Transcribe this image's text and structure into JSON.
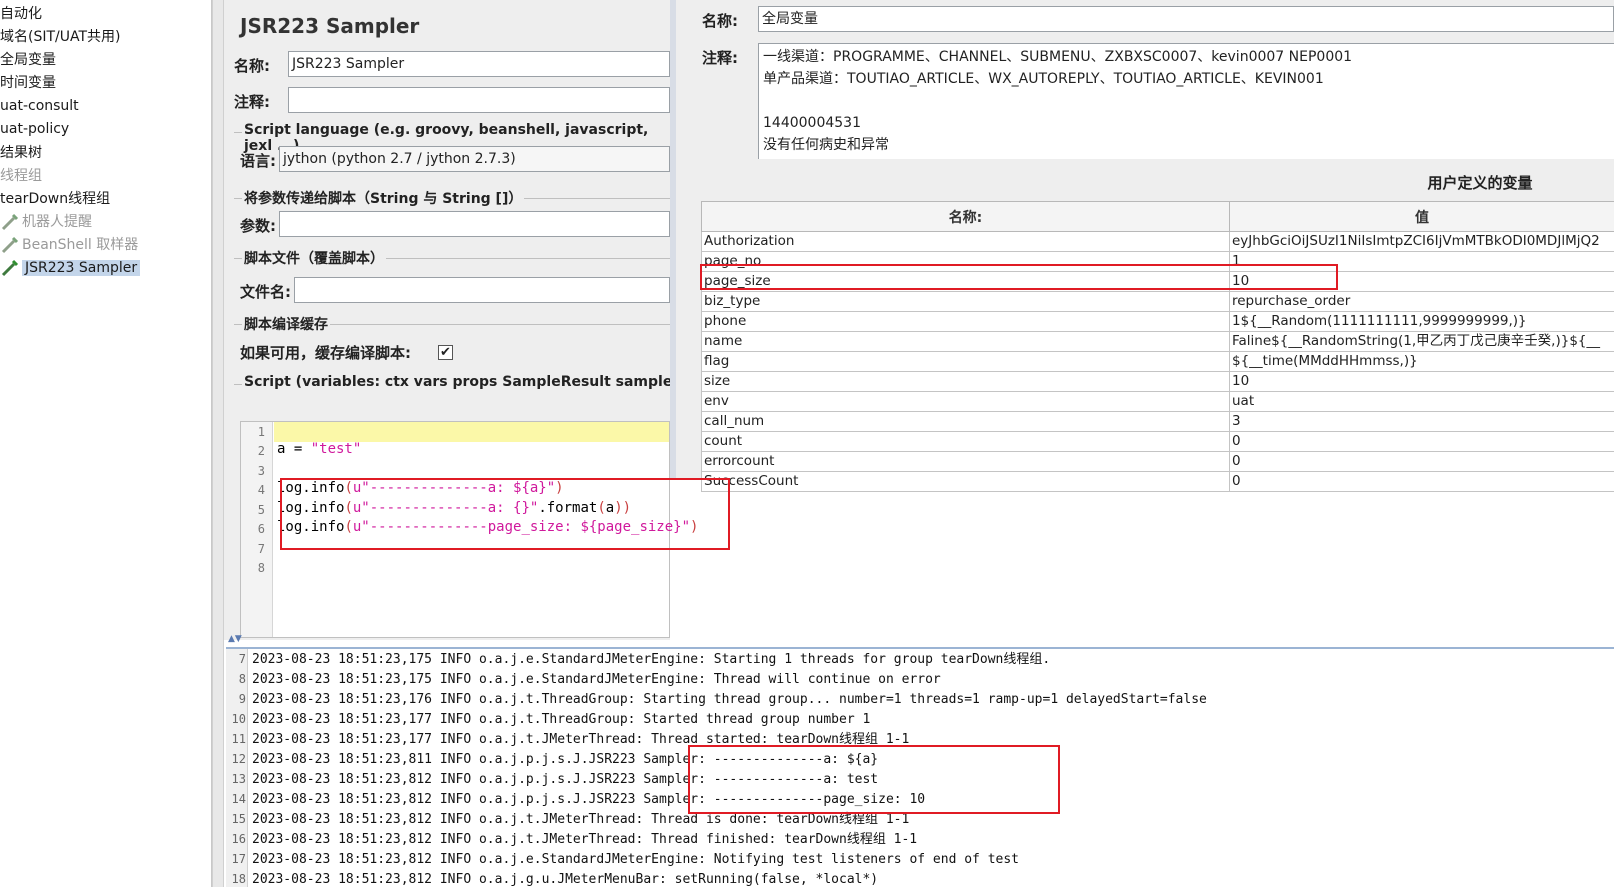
{
  "tree": {
    "items": [
      {
        "label": "自动化",
        "state": "normal"
      },
      {
        "label": "域名(SIT/UAT共用)",
        "state": "normal"
      },
      {
        "label": "全局变量",
        "state": "normal"
      },
      {
        "label": "时间变量",
        "state": "normal"
      },
      {
        "label": "uat-consult",
        "state": "normal"
      },
      {
        "label": "uat-policy",
        "state": "normal"
      },
      {
        "label": "结果树",
        "state": "normal"
      },
      {
        "label": "线程组",
        "state": "disabled"
      },
      {
        "label": "tearDown线程组",
        "state": "normal"
      },
      {
        "label": "机器人提醒",
        "state": "disabled",
        "icon": "pipette-icon"
      },
      {
        "label": "BeanShell 取样器",
        "state": "disabled",
        "icon": "pipette-icon"
      },
      {
        "label": "JSR223 Sampler",
        "state": "selected",
        "icon": "pipette-icon"
      }
    ]
  },
  "sampler": {
    "title": "JSR223 Sampler",
    "name_label": "名称:",
    "name_value": "JSR223 Sampler",
    "comment_label": "注释:",
    "comment_value": "",
    "lang_group": "Script language (e.g. groovy, beanshell, javascript, jexl ...)",
    "lang_label": "语言:",
    "lang_value": "jython     (python 2.7 / jython 2.7.3)",
    "params_group": "将参数传递给脚本（String 与 String []）",
    "params_label": "参数:",
    "params_value": "",
    "file_group": "脚本文件（覆盖脚本）",
    "file_label": "文件名:",
    "file_value": "",
    "cache_group": "脚本编译缓存",
    "cache_label": "如果可用，缓存编译脚本:",
    "cache_checked": "✔",
    "script_group": "Script (variables: ctx vars props SampleResult sampler log"
  },
  "editor": {
    "line_numbers": [
      "1",
      "2",
      "3",
      "4",
      "5",
      "6",
      "7",
      "8"
    ],
    "line2": {
      "plain": "a = ",
      "string": "\"test\""
    },
    "line4": {
      "plain": "log.info",
      "open": "(",
      "string": "u\"--------------a: ${a}\"",
      "close": ")"
    },
    "line5": {
      "plain": "log.info",
      "open": "(",
      "string": "u\"--------------a: {}\"",
      "tail": ".format",
      "open2": "(",
      "arg": "a",
      "close": "))"
    },
    "line6": {
      "plain": "log.info",
      "open": "(",
      "string": "u\"--------------page_size: ${page_size}\"",
      "close": ")"
    }
  },
  "udv": {
    "name_label": "名称:",
    "name_value": "全局变量",
    "comment_label": "注释:",
    "comment_lines": [
      "一线渠道：PROGRAMME、CHANNEL、SUBMENU、ZXBXSC0007、kevin0007  NEP0001",
      "单产品渠道：TOUTIAO_ARTICLE、WX_AUTOREPLY、TOUTIAO_ARTICLE、KEVIN001",
      "",
      "14400004531",
      "没有任何病史和异常"
    ],
    "table_title": "用户定义的变量",
    "col_name": "名称:",
    "col_value": "值",
    "rows": [
      {
        "name": "Authorization",
        "value": "eyJhbGciOiJSUzI1NiIsImtpZCI6IjVmMTBkODI0MDJlMjQ2"
      },
      {
        "name": "page_no",
        "value": "1"
      },
      {
        "name": "page_size",
        "value": "10"
      },
      {
        "name": "biz_type",
        "value": "repurchase_order"
      },
      {
        "name": "phone",
        "value": "1${__Random(1111111111,9999999999,)}"
      },
      {
        "name": "name",
        "value": "Faline${__RandomString(1,甲乙丙丁戊己庚辛壬癸,)}${__"
      },
      {
        "name": "flag",
        "value": "${__time(MMddHHmmss,)}"
      },
      {
        "name": "size",
        "value": "10"
      },
      {
        "name": "env",
        "value": "uat"
      },
      {
        "name": "call_num",
        "value": "3"
      },
      {
        "name": "count",
        "value": "0"
      },
      {
        "name": "errorcount",
        "value": "0"
      },
      {
        "name": "SuccessCount",
        "value": "0"
      }
    ]
  },
  "log": {
    "lines": [
      {
        "n": "7",
        "text": "2023-08-23 18:51:23,175 INFO o.a.j.e.StandardJMeterEngine: Starting 1 threads for group tearDown线程组."
      },
      {
        "n": "8",
        "text": "2023-08-23 18:51:23,175 INFO o.a.j.e.StandardJMeterEngine: Thread will continue on error"
      },
      {
        "n": "9",
        "text": "2023-08-23 18:51:23,176 INFO o.a.j.t.ThreadGroup: Starting thread group... number=1 threads=1 ramp-up=1 delayedStart=false"
      },
      {
        "n": "10",
        "text": "2023-08-23 18:51:23,177 INFO o.a.j.t.ThreadGroup: Started thread group number 1"
      },
      {
        "n": "11",
        "text": "2023-08-23 18:51:23,177 INFO o.a.j.t.JMeterThread: Thread started: tearDown线程组 1-1"
      },
      {
        "n": "12",
        "text": "2023-08-23 18:51:23,811 INFO o.a.j.p.j.s.J.JSR223 Sampler: --------------a: ${a}"
      },
      {
        "n": "13",
        "text": "2023-08-23 18:51:23,812 INFO o.a.j.p.j.s.J.JSR223 Sampler: --------------a: test"
      },
      {
        "n": "14",
        "text": "2023-08-23 18:51:23,812 INFO o.a.j.p.j.s.J.JSR223 Sampler: --------------page_size: 10"
      },
      {
        "n": "15",
        "text": "2023-08-23 18:51:23,812 INFO o.a.j.t.JMeterThread: Thread is done: tearDown线程组 1-1"
      },
      {
        "n": "16",
        "text": "2023-08-23 18:51:23,812 INFO o.a.j.t.JMeterThread: Thread finished: tearDown线程组 1-1"
      },
      {
        "n": "17",
        "text": "2023-08-23 18:51:23,812 INFO o.a.j.e.StandardJMeterEngine: Notifying test listeners of end of test"
      },
      {
        "n": "18",
        "text": "2023-08-23 18:51:23,812 INFO o.a.j.g.u.JMeterMenuBar: setRunning(false, *local*)"
      }
    ]
  },
  "colors": {
    "annotation_red": "#e01b24",
    "selection": "#c3d5ea",
    "string": "#d0199c",
    "current_line": "#fbf8a8"
  }
}
